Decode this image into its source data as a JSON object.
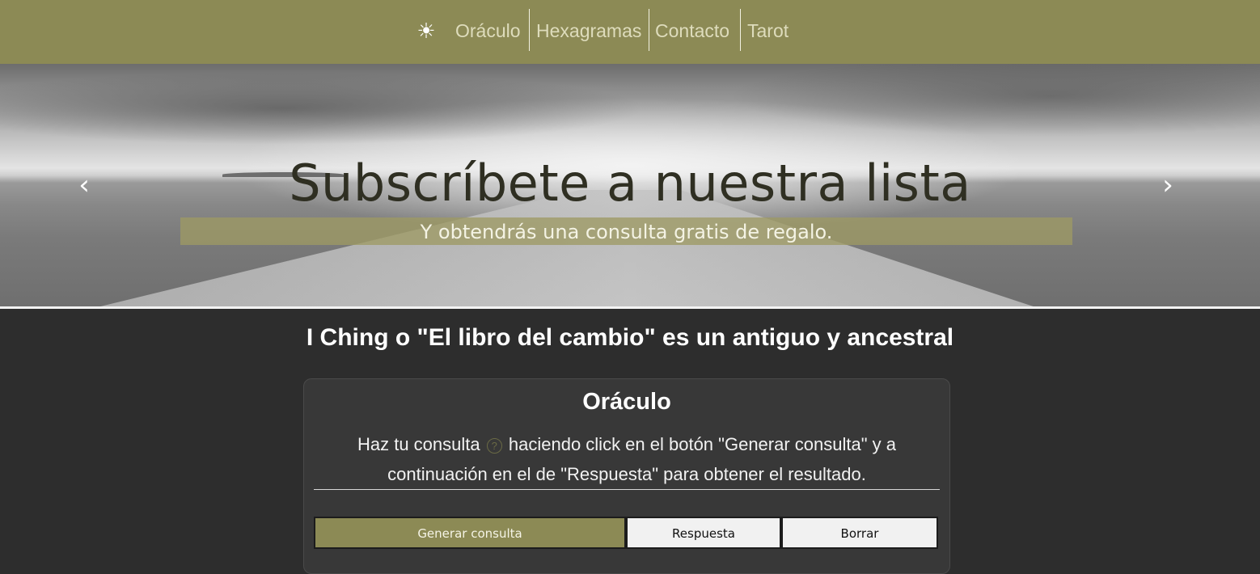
{
  "nav": {
    "theme_icon": "☀",
    "items": [
      {
        "label": "Oráculo"
      },
      {
        "label": "Hexagramas"
      },
      {
        "label": "Contacto"
      },
      {
        "label": "Tarot"
      }
    ]
  },
  "hero": {
    "title": "Subscríbete a nuestra lista",
    "subtitle": "Y obtendrás una consulta gratis de regalo.",
    "prev_arrow": "‹",
    "next_arrow": "›"
  },
  "main": {
    "intro": "I Ching o \"El libro del cambio\" es un antiguo y ancestral"
  },
  "card": {
    "title": "Oráculo",
    "text_before": "Haz tu consulta",
    "help_icon": "?",
    "text_after": "haciendo click en el botón \"Generar consulta\" y a continuación en el de \"Respuesta\" para obtener el resultado.",
    "buttons": {
      "generate": "Generar consulta",
      "answer": "Respuesta",
      "clear": "Borrar"
    }
  },
  "colors": {
    "accent": "#8c8a55",
    "background": "#2d2d2d",
    "card": "#383838"
  }
}
